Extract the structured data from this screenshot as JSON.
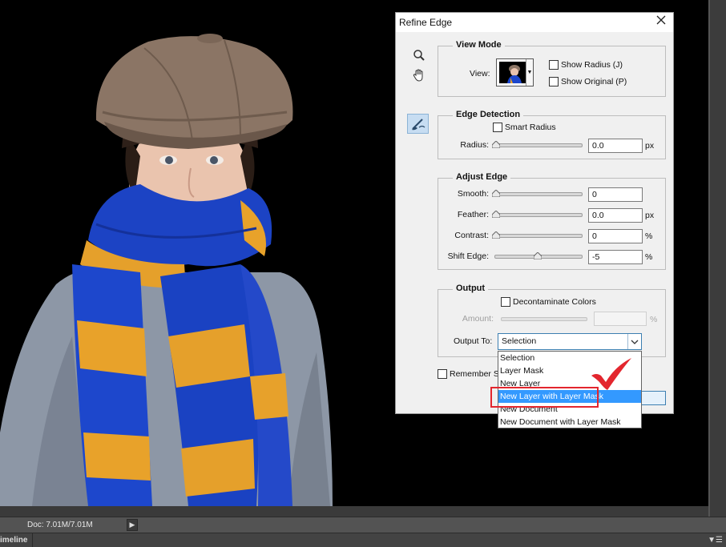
{
  "dialog": {
    "title": "Refine Edge",
    "close_icon": "close-icon"
  },
  "tools": {
    "zoom_icon": "magnifier-icon",
    "hand_icon": "hand-icon",
    "refine_radius_icon": "refine-radius-brush-icon"
  },
  "view_mode": {
    "title": "View Mode",
    "view_label": "View:",
    "show_radius_label": "Show Radius (J)",
    "show_original_label": "Show Original (P)"
  },
  "edge_detection": {
    "title": "Edge Detection",
    "smart_radius_label": "Smart Radius",
    "radius_label": "Radius:",
    "radius_value": "0.0",
    "radius_unit": "px"
  },
  "adjust_edge": {
    "title": "Adjust Edge",
    "smooth_label": "Smooth:",
    "smooth_value": "0",
    "feather_label": "Feather:",
    "feather_value": "0.0",
    "feather_unit": "px",
    "contrast_label": "Contrast:",
    "contrast_value": "0",
    "contrast_unit": "%",
    "shift_edge_label": "Shift Edge:",
    "shift_edge_value": "-5",
    "shift_edge_unit": "%"
  },
  "output": {
    "title": "Output",
    "decontaminate_label": "Decontaminate Colors",
    "amount_label": "Amount:",
    "amount_unit": "%",
    "output_to_label": "Output To:",
    "output_to_value": "Selection",
    "remember_label": "Remember Se"
  },
  "dropdown": {
    "options": [
      "Selection",
      "Layer Mask",
      "New Layer",
      "New Layer with Layer Mask",
      "New Document",
      "New Document with Layer Mask"
    ],
    "highlighted": "New Layer with Layer Mask"
  },
  "status_bar": {
    "doc_info": "Doc: 7.01M/7.01M",
    "timeline_label": "imeline"
  },
  "colors": {
    "highlight_blue": "#3399ff",
    "annotation_red": "#e3262e"
  }
}
